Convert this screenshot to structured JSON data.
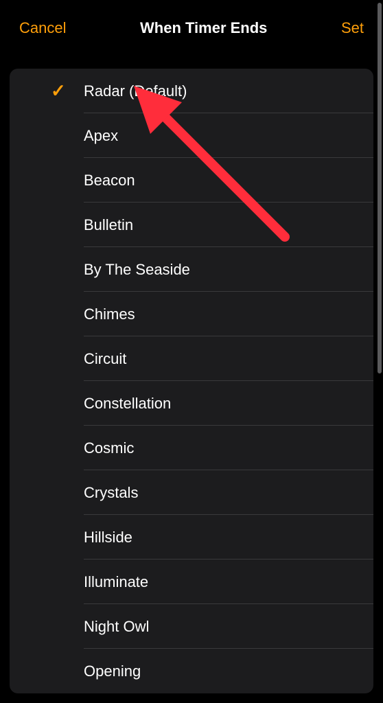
{
  "header": {
    "cancel_label": "Cancel",
    "title": "When Timer Ends",
    "set_label": "Set"
  },
  "sounds": {
    "selected_index": 0,
    "items": [
      {
        "label": "Radar (Default)"
      },
      {
        "label": "Apex"
      },
      {
        "label": "Beacon"
      },
      {
        "label": "Bulletin"
      },
      {
        "label": "By The Seaside"
      },
      {
        "label": "Chimes"
      },
      {
        "label": "Circuit"
      },
      {
        "label": "Constellation"
      },
      {
        "label": "Cosmic"
      },
      {
        "label": "Crystals"
      },
      {
        "label": "Hillside"
      },
      {
        "label": "Illuminate"
      },
      {
        "label": "Night Owl"
      },
      {
        "label": "Opening"
      }
    ]
  },
  "annotation": {
    "arrow_color": "#ff2d3b"
  }
}
